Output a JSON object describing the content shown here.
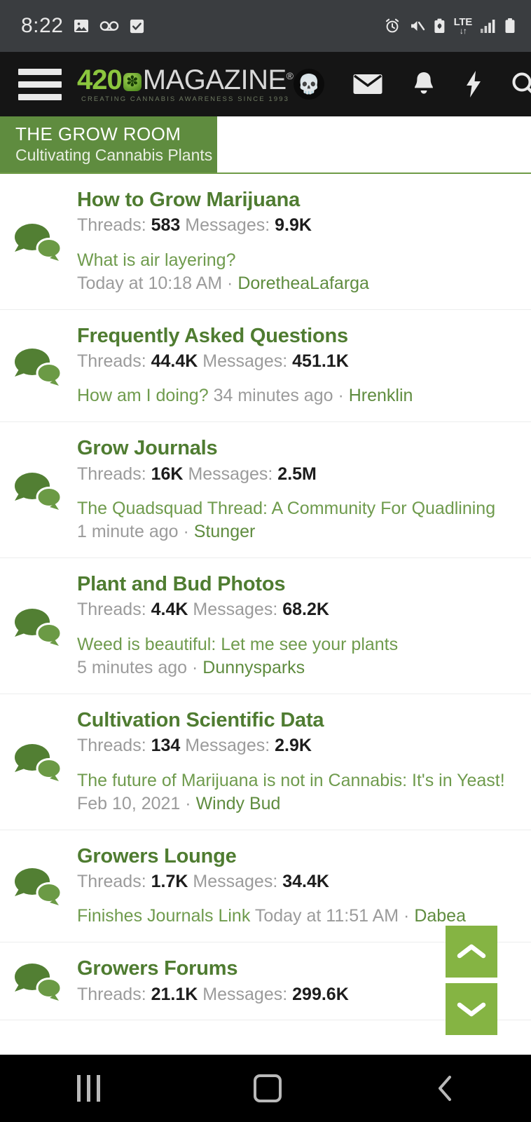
{
  "status_bar": {
    "clock": "8:22",
    "left_icons": [
      "image-icon",
      "voicemail-icon",
      "checkbox-checked-icon"
    ],
    "right_icons": [
      "alarm-icon",
      "volume-muted-icon",
      "battery-saver-icon",
      "signal-bars-icon",
      "battery-icon"
    ],
    "network_label": "LTE",
    "network_arrows": "↓↑"
  },
  "header": {
    "menu_icon": "hamburger-menu-icon",
    "logo_number": "420",
    "logo_word": "MAGAZINE",
    "logo_registered": "®",
    "logo_tagline": "CREATING CANNABIS AWARENESS SINCE 1993",
    "icons": [
      "user-avatar",
      "mail-icon",
      "bell-icon",
      "lightning-bolt-icon",
      "search-icon"
    ]
  },
  "banner": {
    "title": "THE GROW ROOM",
    "subtitle": "Cultivating Cannabis Plants"
  },
  "labels": {
    "threads": "Threads:",
    "messages": "Messages:",
    "separator": "·"
  },
  "forums": [
    {
      "name": "How to Grow Marijuana",
      "threads": "583",
      "messages": "9.9K",
      "last_thread": "What is air layering?",
      "last_time": "Today at 10:18 AM",
      "last_user": "DoretheaLafarga",
      "inline": false
    },
    {
      "name": "Frequently Asked Questions",
      "threads": "44.4K",
      "messages": "451.1K",
      "last_thread": "How am I doing?",
      "last_time": "34 minutes ago",
      "last_user": "Hrenklin",
      "inline": true
    },
    {
      "name": "Grow Journals",
      "threads": "16K",
      "messages": "2.5M",
      "last_thread": "The Quadsquad Thread: A Community For Quadlining",
      "last_time": "1 minute ago",
      "last_user": "Stunger",
      "inline": false
    },
    {
      "name": "Plant and Bud Photos",
      "threads": "4.4K",
      "messages": "68.2K",
      "last_thread": "Weed is beautiful: Let me see your plants",
      "last_time": "5 minutes ago",
      "last_user": "Dunnysparks",
      "inline": false
    },
    {
      "name": "Cultivation Scientific Data",
      "threads": "134",
      "messages": "2.9K",
      "last_thread": "The future of Marijuana is not in Cannabis: It's in Yeast!",
      "last_time": "Feb 10, 2021",
      "last_user": "Windy Bud",
      "inline": false
    },
    {
      "name": "Growers Lounge",
      "threads": "1.7K",
      "messages": "34.4K",
      "last_thread": "Finishes Journals Link",
      "last_time": "Today at 11:51 AM",
      "last_user": "Dabea",
      "inline": true
    },
    {
      "name": "Growers Forums",
      "threads": "21.1K",
      "messages": "299.6K",
      "last_thread": "",
      "last_time": "",
      "last_user": "",
      "inline": false
    }
  ],
  "scroll_controls": {
    "up_icon": "chevron-up-icon",
    "down_icon": "chevron-down-icon"
  },
  "android_nav": {
    "recents_icon": "recents-icon",
    "home_icon": "home-icon",
    "back_icon": "back-chevron-icon"
  },
  "colors": {
    "banner_green": "#5f8c3f",
    "title_green": "#4f7c31",
    "link_green": "#6f9b4d",
    "button_green": "#85b443",
    "logo_green": "#8cc63e",
    "status_bar_bg": "#3a3d40",
    "app_bar_bg": "#151515"
  }
}
